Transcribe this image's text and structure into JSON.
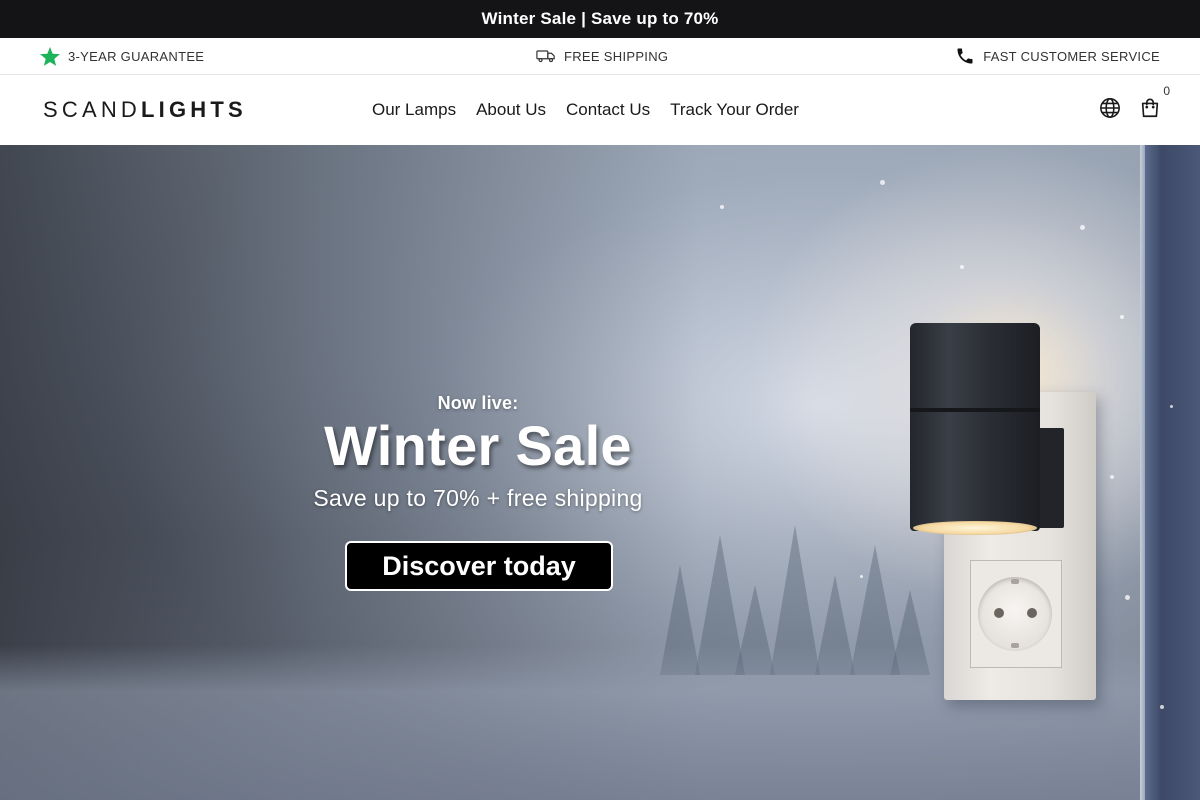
{
  "announcement": {
    "text": "Winter Sale | Save up to 70%"
  },
  "usp": {
    "items": [
      {
        "icon": "star-icon",
        "label": "3-YEAR GUARANTEE",
        "color": "#1db35a"
      },
      {
        "icon": "truck-icon",
        "label": "FREE SHIPPING"
      },
      {
        "icon": "phone-icon",
        "label": "FAST CUSTOMER SERVICE"
      }
    ]
  },
  "header": {
    "logo_light": "SCAND",
    "logo_bold": "LIGHTS",
    "nav": [
      {
        "label": "Our Lamps"
      },
      {
        "label": "About Us"
      },
      {
        "label": "Contact Us"
      },
      {
        "label": "Track Your Order"
      }
    ],
    "icons": {
      "language": "globe-icon",
      "cart": "shopping-bag-icon"
    },
    "cart_count": "0"
  },
  "hero": {
    "kicker": "Now live:",
    "title": "Winter Sale",
    "subtitle": "Save up to 70% + free shipping",
    "cta": "Discover today"
  },
  "colors": {
    "announcement_bg": "#141417",
    "accent_green": "#1db35a",
    "cta_bg": "#000000"
  }
}
